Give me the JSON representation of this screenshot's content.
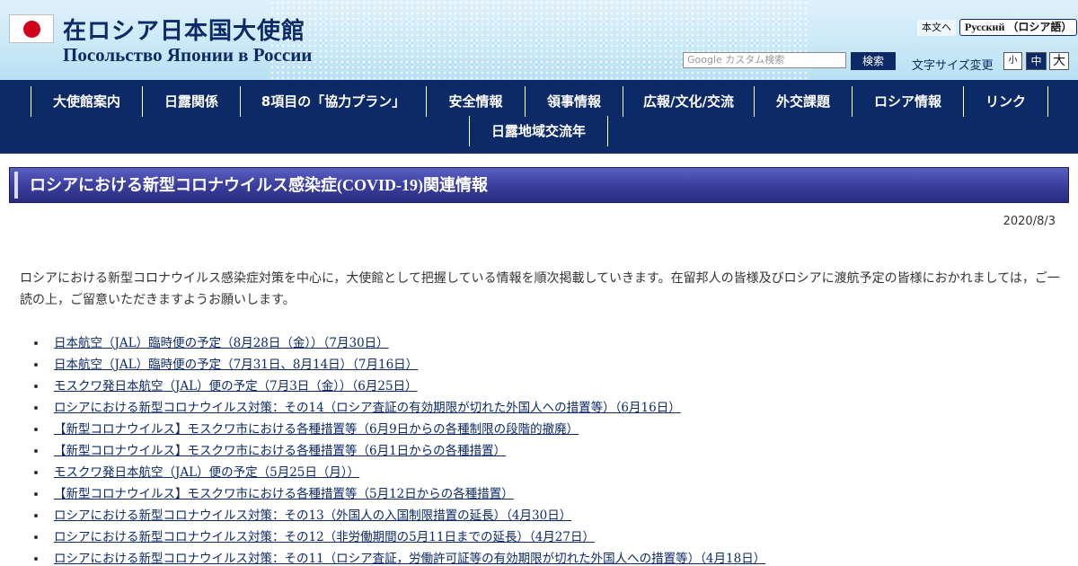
{
  "header": {
    "title_ja": "在ロシア日本国大使館",
    "title_ru": "Посольство Японии в России",
    "lang_main": "本文へ",
    "lang_ru": "Русский （ロシア語）",
    "search_placeholder": "Google カスタム検索",
    "search_button": "検索",
    "font_size_label": "文字サイズ変更",
    "font_small": "小",
    "font_medium": "中",
    "font_large": "大"
  },
  "nav": {
    "items": [
      {
        "label": "大使館案内"
      },
      {
        "label": "日露関係"
      },
      {
        "label": "8項目の「協力プラン」"
      },
      {
        "label": "安全情報"
      },
      {
        "label": "領事情報"
      },
      {
        "label": "広報/文化/交流"
      },
      {
        "label": "外交課題"
      },
      {
        "label": "ロシア情報"
      },
      {
        "label": "リンク"
      },
      {
        "label": "日露地域交流年"
      }
    ]
  },
  "main": {
    "heading": "ロシアにおける新型コロナウイルス感染症(COVID-19)関連情報",
    "date": "2020/8/3",
    "intro": "ロシアにおける新型コロナウイルス感染症対策を中心に，大使館として把握している情報を順次掲載していきます。在留邦人の皆様及びロシアに渡航予定の皆様におかれましては，ご一読の上，ご留意いただきますようお願いします。",
    "links": [
      "日本航空（JAL）臨時便の予定（8月28日（金））（7月30日）",
      "日本航空（JAL）臨時便の予定（7月31日、8月14日）（7月16日）",
      "モスクワ発日本航空（JAL）便の予定（7月3日（金））（6月25日）",
      "ロシアにおける新型コロナウイルス対策：その14（ロシア査証の有効期限が切れた外国人への措置等）（6月16日）",
      "【新型コロナウイルス】モスクワ市における各種措置等（6月9日からの各種制限の段階的撤廃）",
      "【新型コロナウイルス】モスクワ市における各種措置等（6月1日からの各種措置）",
      "モスクワ発日本航空（JAL）便の予定（5月25日（月））",
      "【新型コロナウイルス】モスクワ市における各種措置等（5月12日からの各種措置）",
      "ロシアにおける新型コロナウイルス対策：その13（外国人の入国制限措置の延長）（4月30日）",
      "ロシアにおける新型コロナウイルス対策：その12（非労働期間の5月11日までの延長）（4月27日）",
      "ロシアにおける新型コロナウイルス対策：その11（ロシア査証，労働許可証等の有効期限が切れた外国人への措置等）（4月18日）"
    ]
  },
  "colors": {
    "navy": "#0c2a66",
    "heading_purple": "#3c3f9f",
    "flag_red": "#d0021b"
  }
}
